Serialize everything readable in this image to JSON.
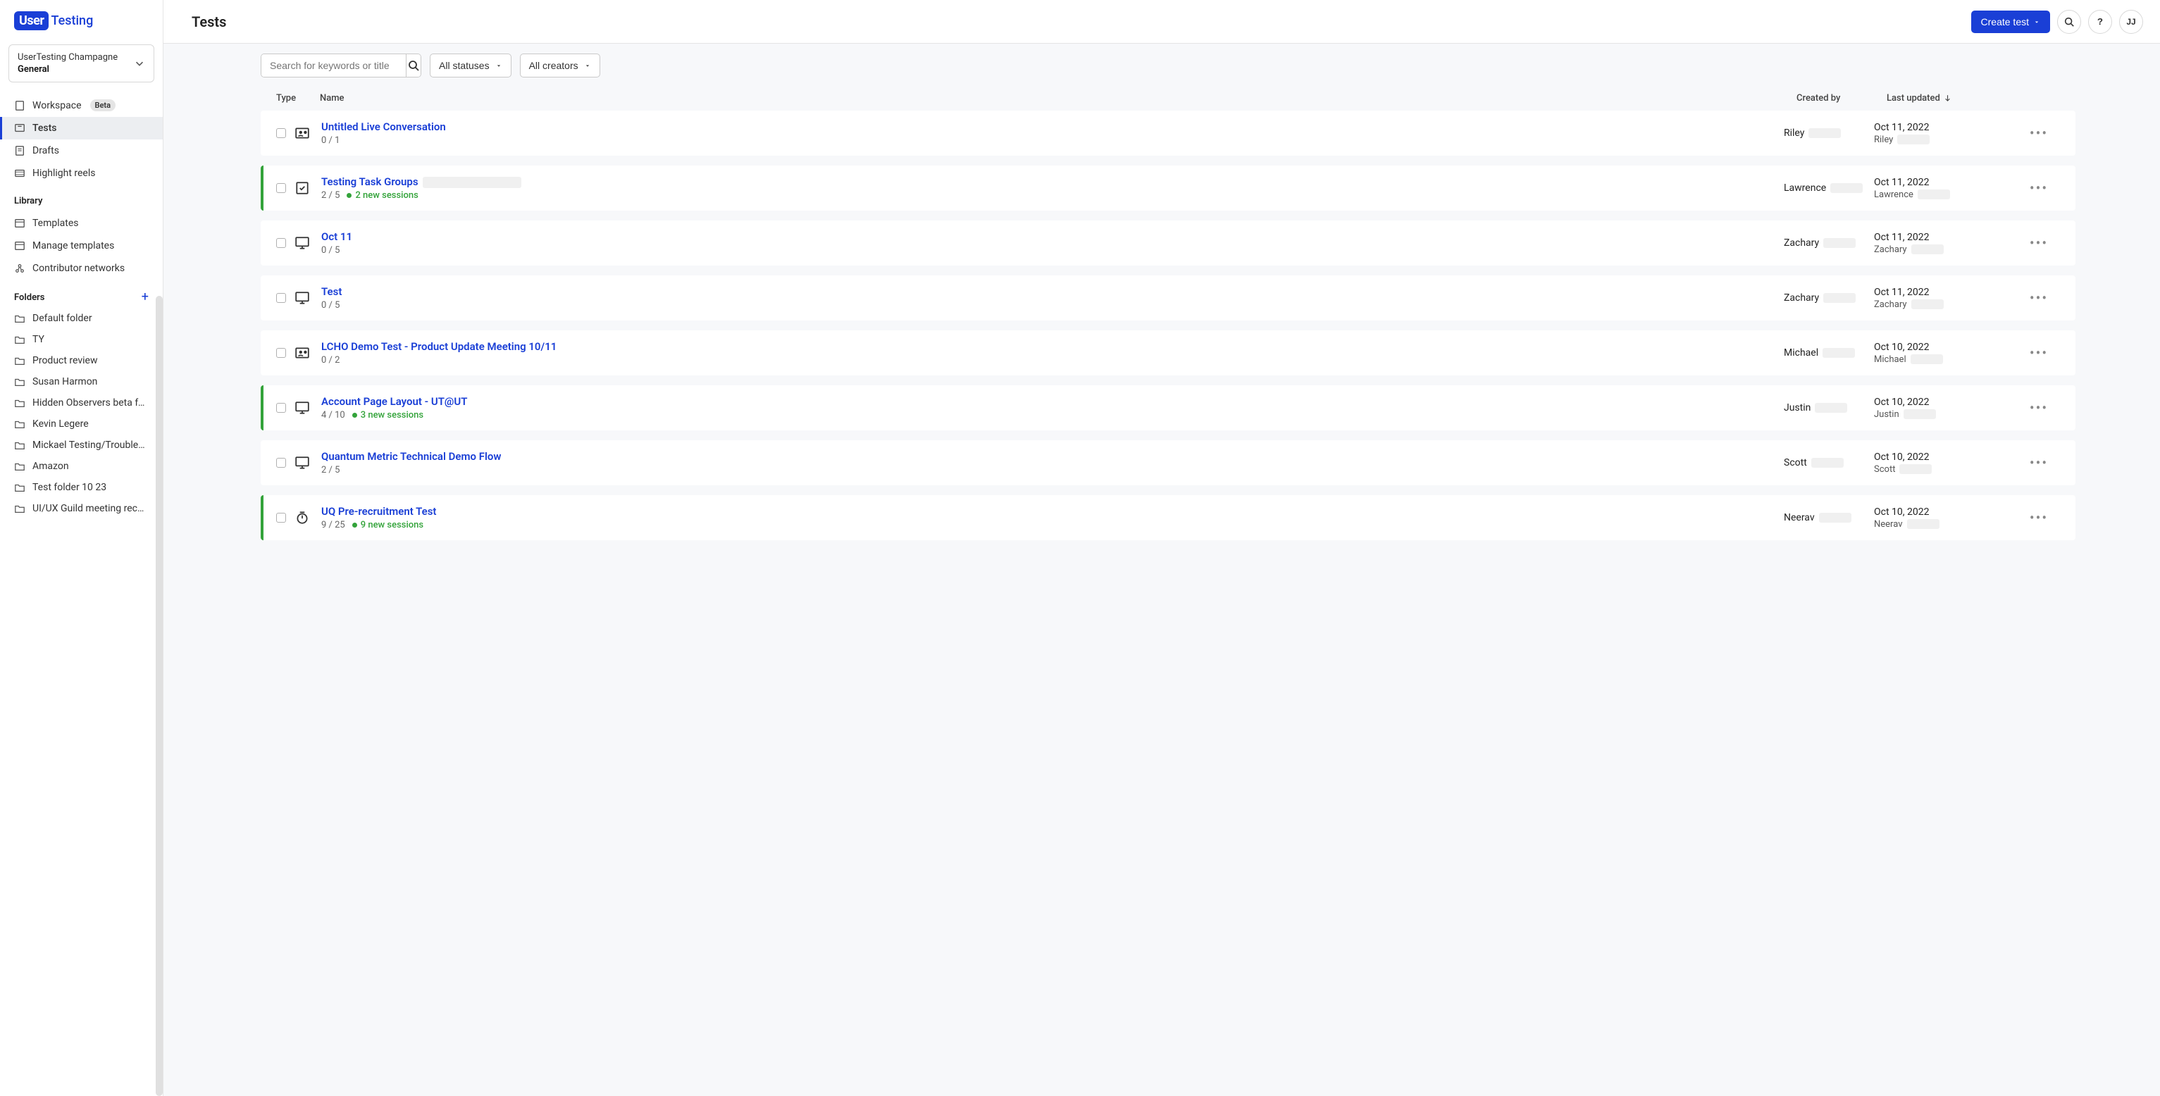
{
  "logo": {
    "mark": "User",
    "text": "Testing"
  },
  "workspace": {
    "org": "UserTesting Champagne",
    "name": "General"
  },
  "nav": {
    "workspace": "Workspace",
    "workspace_badge": "Beta",
    "tests": "Tests",
    "drafts": "Drafts",
    "highlight_reels": "Highlight reels"
  },
  "library_label": "Library",
  "library": {
    "templates": "Templates",
    "manage_templates": "Manage templates",
    "contributor_networks": "Contributor networks"
  },
  "folders_label": "Folders",
  "folders": [
    "Default folder",
    "TY",
    "Product review",
    "Susan Harmon",
    "Hidden Observers beta fee...",
    "Kevin Legere",
    "Mickael Testing/Troublesho...",
    "Amazon",
    "Test folder 10 23",
    "UI/UX Guild meeting record..."
  ],
  "header": {
    "title": "Tests",
    "create_button": "Create test",
    "avatar": "JJ"
  },
  "filters": {
    "search_placeholder": "Search for keywords or title",
    "statuses": "All statuses",
    "creators": "All creators"
  },
  "columns": {
    "type": "Type",
    "name": "Name",
    "created_by": "Created by",
    "last_updated": "Last updated"
  },
  "tests": [
    {
      "title": "Untitled Live Conversation",
      "count": "0 / 1",
      "new_sessions": "",
      "accent": false,
      "icon": "conversation",
      "creator": "Riley",
      "updated": "Oct 11, 2022",
      "updater": "Riley",
      "title_redact": false
    },
    {
      "title": "Testing Task Groups",
      "count": "2 / 5",
      "new_sessions": "2 new sessions",
      "accent": true,
      "icon": "task",
      "creator": "Lawrence",
      "updated": "Oct 11, 2022",
      "updater": "Lawrence",
      "title_redact": true
    },
    {
      "title": "Oct 11",
      "count": "0 / 5",
      "new_sessions": "",
      "accent": false,
      "icon": "screen",
      "creator": "Zachary",
      "updated": "Oct 11, 2022",
      "updater": "Zachary",
      "title_redact": false
    },
    {
      "title": "Test",
      "count": "0 / 5",
      "new_sessions": "",
      "accent": false,
      "icon": "screen",
      "creator": "Zachary",
      "updated": "Oct 11, 2022",
      "updater": "Zachary",
      "title_redact": false
    },
    {
      "title": "LCHO Demo Test - Product Update Meeting 10/11",
      "count": "0 / 2",
      "new_sessions": "",
      "accent": false,
      "icon": "conversation",
      "creator": "Michael",
      "updated": "Oct 10, 2022",
      "updater": "Michael",
      "title_redact": false
    },
    {
      "title": "Account Page Layout - UT@UT",
      "count": "4 / 10",
      "new_sessions": "3 new sessions",
      "accent": true,
      "icon": "screen",
      "creator": "Justin",
      "updated": "Oct 10, 2022",
      "updater": "Justin",
      "title_redact": false
    },
    {
      "title": "Quantum Metric Technical Demo Flow",
      "count": "2 / 5",
      "new_sessions": "",
      "accent": false,
      "icon": "screen",
      "creator": "Scott",
      "updated": "Oct 10, 2022",
      "updater": "Scott",
      "title_redact": false
    },
    {
      "title": "UQ Pre-recruitment Test",
      "count": "9 / 25",
      "new_sessions": "9 new sessions",
      "accent": true,
      "icon": "timer",
      "creator": "Neerav",
      "updated": "Oct 10, 2022",
      "updater": "Neerav",
      "title_redact": false
    }
  ]
}
